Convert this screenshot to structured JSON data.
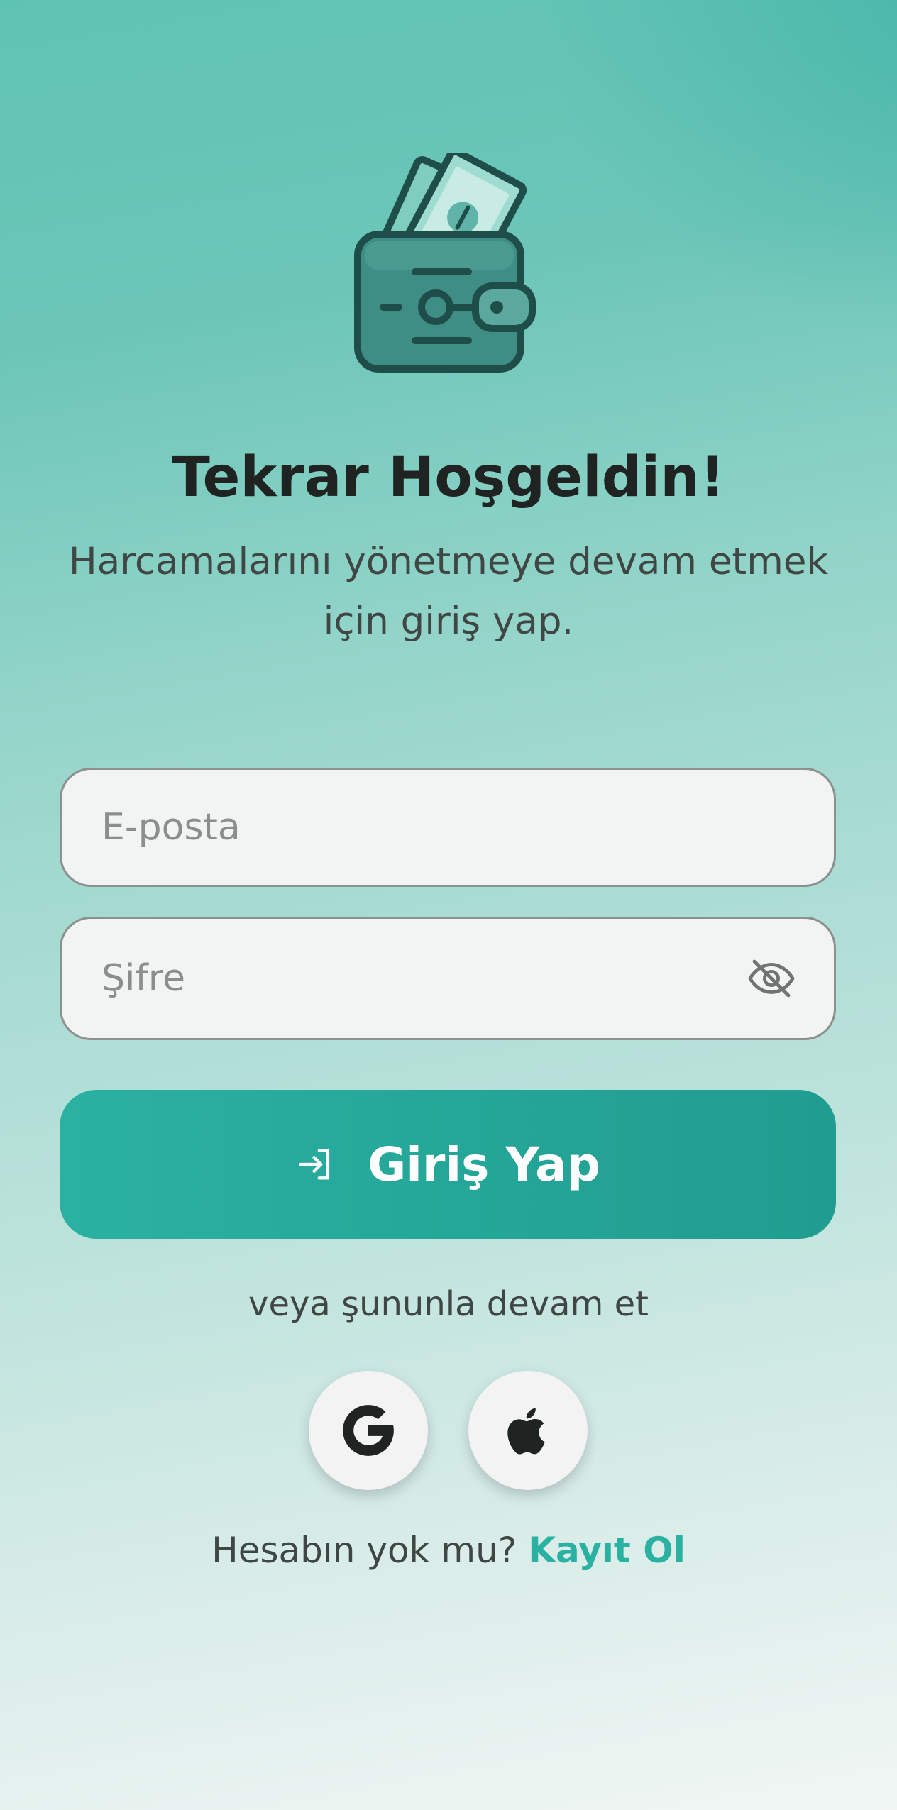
{
  "header": {
    "title": "Tekrar Hoşgeldin!",
    "subtitle": "Harcamalarını yönetmeye devam etmek için giriş yap."
  },
  "logo": {
    "icon": "wallet-with-money-icon"
  },
  "form": {
    "email_placeholder": "E-posta",
    "email_value": "",
    "password_placeholder": "Şifre",
    "password_value": "",
    "password_toggle_icon": "eye-off-icon",
    "login_button_label": "Giriş Yap",
    "login_button_icon": "login-icon"
  },
  "social": {
    "divider_text": "veya şununla devam et",
    "providers": [
      {
        "name": "google",
        "icon": "google-icon"
      },
      {
        "name": "apple",
        "icon": "apple-icon"
      }
    ]
  },
  "footer": {
    "prompt": "Hesabın yok mu?",
    "link_label": "Kayıt Ol"
  },
  "colors": {
    "accent": "#2bb1a2",
    "wallet": "#3f8e85",
    "text_dark": "#1f2321"
  }
}
